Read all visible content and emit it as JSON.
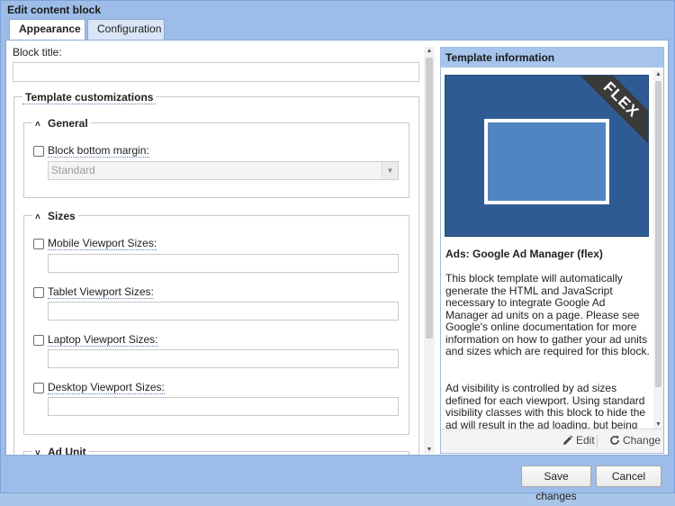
{
  "window": {
    "title": "Edit content block"
  },
  "tabs": [
    {
      "label": "Appearance",
      "active": true
    },
    {
      "label": "Configuration",
      "active": false
    }
  ],
  "form": {
    "block_title_label": "Block title:",
    "block_title_value": "",
    "customizations_legend": "Template customizations",
    "groups": {
      "general": {
        "legend": "General",
        "block_bottom_margin": {
          "label": "Block bottom margin:",
          "checked": false,
          "select_value": "Standard"
        }
      },
      "sizes": {
        "legend": "Sizes",
        "fields": [
          {
            "label": "Mobile Viewport Sizes:",
            "checked": false,
            "value": ""
          },
          {
            "label": "Tablet Viewport Sizes:",
            "checked": false,
            "value": ""
          },
          {
            "label": "Laptop Viewport Sizes:",
            "checked": false,
            "value": ""
          },
          {
            "label": "Desktop Viewport Sizes:",
            "checked": false,
            "value": ""
          }
        ]
      },
      "ad_unit": {
        "legend": "Ad Unit"
      }
    }
  },
  "info": {
    "header": "Template information",
    "badge": "FLEX",
    "template_name": "Ads: Google Ad Manager (flex)",
    "paragraph1": "This block template will automatically generate the HTML and JavaScript necessary to integrate Google Ad Manager ad units on a page. Please see Google's online documentation for more information on how to gather your ad units and sizes which are required for this block.",
    "paragraph2": "Ad visibility is controlled by ad sizes defined for each viewport. Using standard visibility classes with this block to hide the ad will result in the ad loading, but being",
    "edit_label": "Edit",
    "change_label": "Change"
  },
  "footer": {
    "save_label": "Save changes",
    "cancel_label": "Cancel"
  },
  "colors": {
    "window_bg": "#9dbde8",
    "info_header": "#a6c4ec",
    "preview_bg": "#2e5b93",
    "preview_frame_fill": "#4f86c2"
  }
}
